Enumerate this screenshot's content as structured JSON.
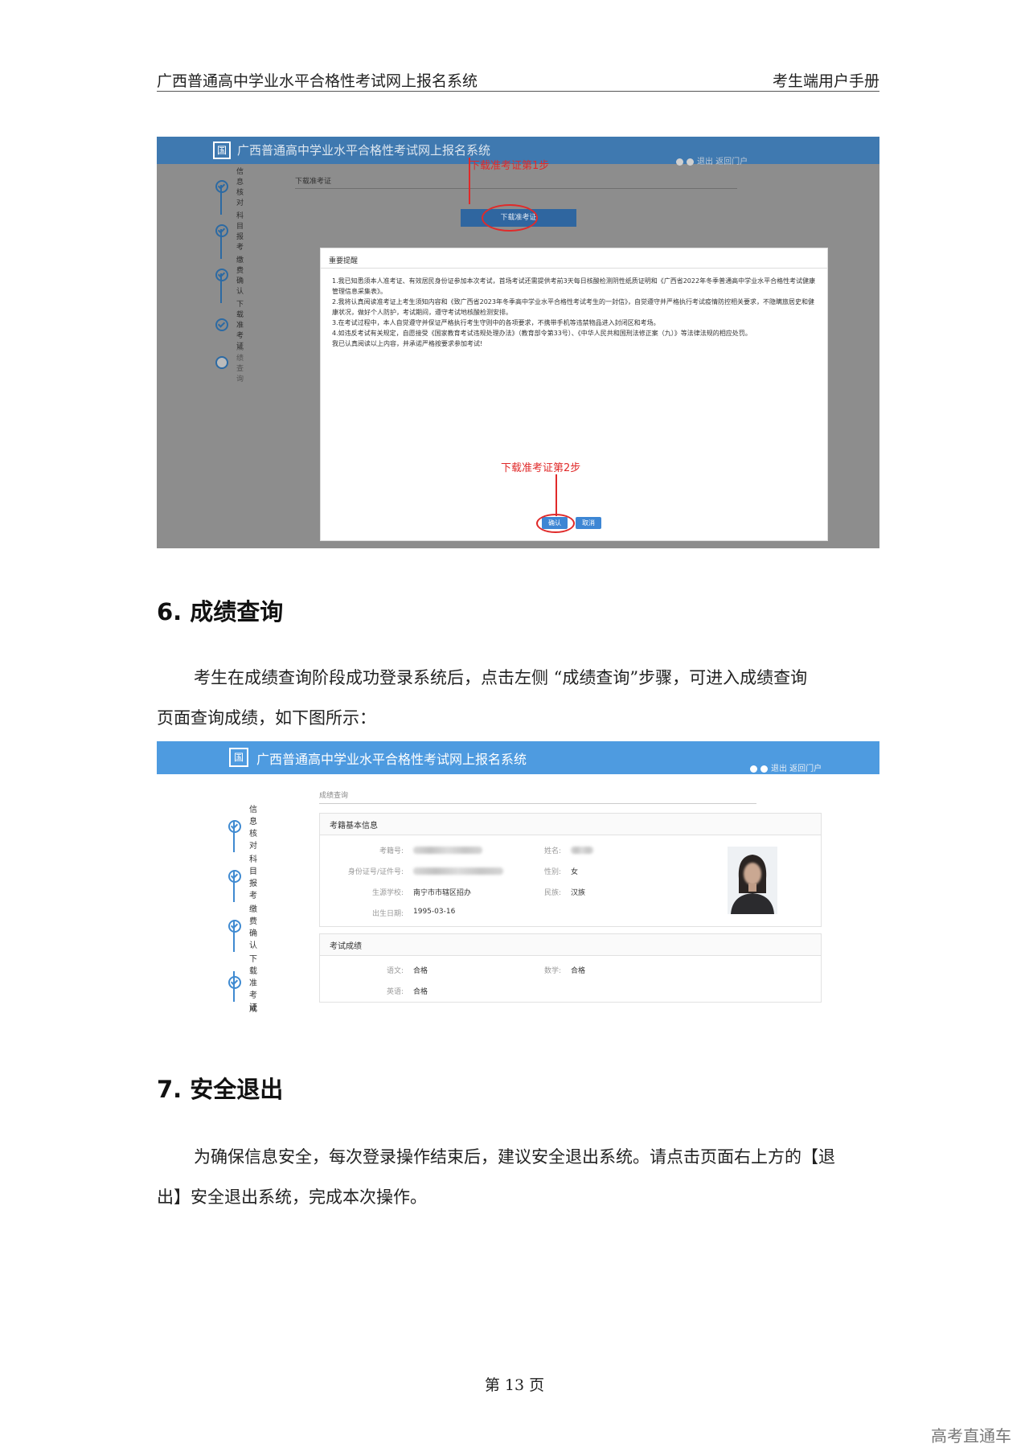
{
  "doc_header": {
    "left": "广西普通高中学业水平合格性考试网上报名系统",
    "right": "考生端用户手册"
  },
  "screenshot1": {
    "app_title": "广西普通高中学业水平合格性考试网上报名系统",
    "logo_glyph": "国",
    "top_links": "退出 返回门户",
    "steps": [
      "信息核对",
      "科目报考",
      "缴费确认",
      "下载准考证",
      "成绩查询"
    ],
    "breadcrumb": "下载准考证",
    "download_button": "下载准考证",
    "annotation_step1": "下载准考证第1步",
    "annotation_step2": "下载准考证第2步",
    "modal": {
      "title": "重要提醒",
      "lines": [
        "1.我已知悉须本人准考证、有效居民身份证参加本次考试，首场考试还需提供考前3天每日核酸检测阴性纸质证明和《广西省2022年冬季普通高中学业水平合格性考试健康管理信息采集表》。",
        "2.我将认真阅读准考证上考生须知内容和《致广西省2023年冬季高中学业水平合格性考试考生的一封信》，自觉遵守并严格执行考试疫情防控相关要求，不隐瞒旅居史和健康状况，做好个人防护，考试期间，遵守考试地核酸检测安排。",
        "3.在考试过程中，本人自觉遵守并保证严格执行考生守则中的各项要求，不携带手机等违禁物品进入封闭区和考场。",
        "4.如违反考试有关规定，自愿接受《国家教育考试违规处理办法》（教育部令第33号）、《中华人民共和国刑法修正案（九）》等法律法规的相应处罚。",
        "我已认真阅读以上内容，并承诺严格按要求参加考试!"
      ],
      "confirm": "确认",
      "cancel": "取消"
    }
  },
  "section6": {
    "heading": "6.  成绩查询",
    "para_line1": "考生在成绩查询阶段成功登录系统后，点击左侧 “成绩查询”步骤，可进入成绩查询",
    "para_line2": "页面查询成绩，如下图所示："
  },
  "screenshot2": {
    "app_title": "广西普通高中学业水平合格性考试网上报名系统",
    "logo_glyph": "国",
    "top_links": "退出 返回门户",
    "steps": [
      "信息核对",
      "科目报考",
      "缴费确认",
      "下载准考证",
      "成绩查询"
    ],
    "breadcrumb": "成绩查询",
    "basic_panel": {
      "title": "考籍基本信息",
      "labels": {
        "exam_no": "考籍号:",
        "id_no": "身份证号/证件号:",
        "school": "生源学校:",
        "birth": "出生日期:",
        "name": "姓名:",
        "gender": "性别:",
        "ethnicity": "民族:"
      },
      "values": {
        "school": "南宁市市辖区招办",
        "birth": "1995-03-16",
        "gender": "女",
        "ethnicity": "汉族"
      }
    },
    "score_panel": {
      "title": "考试成绩",
      "subjects": [
        {
          "label": "语文:",
          "value": "合格"
        },
        {
          "label": "数学:",
          "value": "合格"
        },
        {
          "label": "英语:",
          "value": "合格"
        }
      ]
    }
  },
  "section7": {
    "heading": "7.  安全退出",
    "para_line1": "为确保信息安全，每次登录操作结束后，建议安全退出系统。请点击页面右上方的【退",
    "para_line2": "出】安全退出系统，完成本次操作。"
  },
  "footer": {
    "page": "第 13 页",
    "watermark": "高考直通车"
  },
  "colors": {
    "header_blue": "#4e9be0",
    "annotation_red": "#e02a2a",
    "step_blue": "#3f8ad1"
  }
}
